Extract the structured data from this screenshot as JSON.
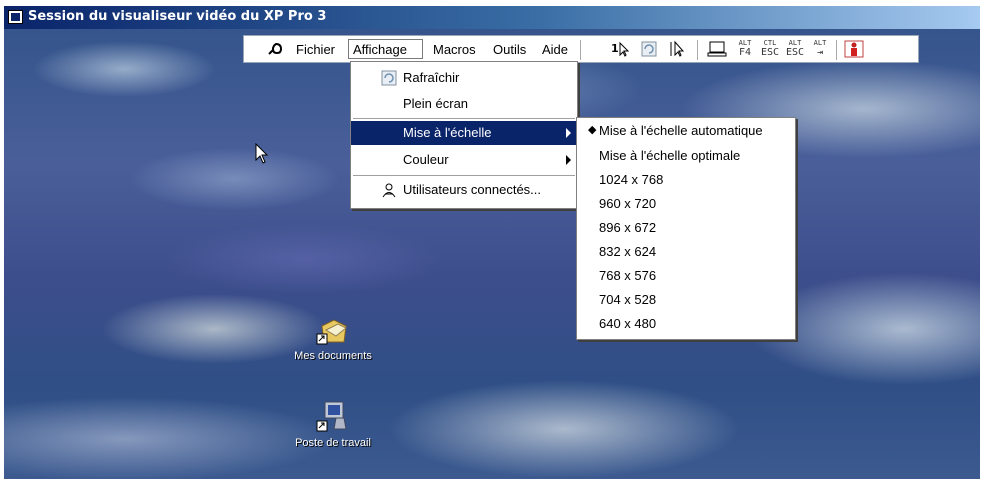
{
  "window": {
    "title": "Session du visualiseur vidéo du XP Pro 3"
  },
  "toolbar": {
    "menus": [
      "Fichier",
      "Affichage",
      "Macros",
      "Outils",
      "Aide"
    ],
    "active_menu": "Affichage",
    "keys": [
      {
        "top": "ALT",
        "bottom": "F4"
      },
      {
        "top": "CTL",
        "bottom": "ESC"
      },
      {
        "top": "ALT",
        "bottom": "ESC"
      },
      {
        "top": "ALT",
        "bottom": "⇥"
      }
    ]
  },
  "affichage_menu": {
    "items": [
      {
        "label": "Rafraîchir",
        "icon": "refresh-icon"
      },
      {
        "label": "Plein écran"
      },
      {
        "label": "Mise à l'échelle",
        "submenu": true,
        "selected": true
      },
      {
        "label": "Couleur",
        "submenu": true
      },
      {
        "label": "Utilisateurs connectés...",
        "icon": "users-icon"
      }
    ]
  },
  "scale_submenu": {
    "items": [
      {
        "label": "Mise à l'échelle automatique",
        "checked": true
      },
      {
        "label": "Mise à l'échelle optimale"
      },
      {
        "label": "1024 x 768"
      },
      {
        "label": "960 x 720"
      },
      {
        "label": "896 x 672"
      },
      {
        "label": "832 x 624"
      },
      {
        "label": "768 x 576"
      },
      {
        "label": "704 x 528"
      },
      {
        "label": "640 x 480"
      }
    ]
  },
  "desktop": {
    "icons": [
      {
        "label": "Mes documents"
      },
      {
        "label": "Poste de travail"
      }
    ]
  }
}
